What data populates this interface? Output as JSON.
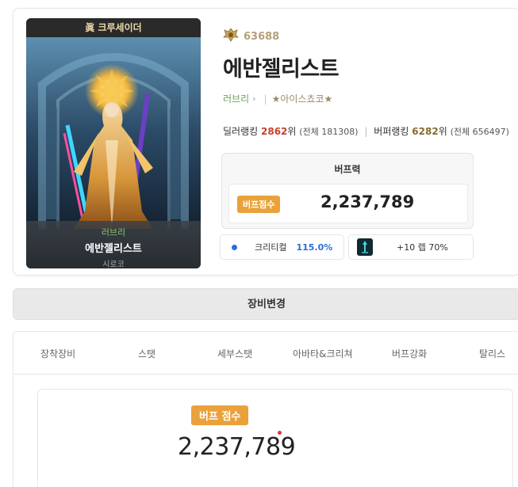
{
  "character": {
    "banner": "眞 크루세이더",
    "guild": "러브리",
    "name": "에반젤리스트",
    "server": "시로코",
    "fame": "63688",
    "adventure": "러브리",
    "title_tag": "★아이스쵸코★"
  },
  "ranking": {
    "dealer_label": "딜러랭킹",
    "dealer_rank": "2862",
    "dealer_suffix": "위",
    "dealer_total": "(전체 181308)",
    "buffer_label": "버퍼랭킹",
    "buffer_rank": "6282",
    "buffer_suffix": "위",
    "buffer_total": "(전체 656497)"
  },
  "buff": {
    "heading": "버프력",
    "badge": "버프점수",
    "score": "2,237,789"
  },
  "stats": {
    "crit_label": "크리티컬",
    "crit_value": "115.0%",
    "item_text": "+10 렙 70%"
  },
  "equip_change_label": "장비변경",
  "tabs": [
    "장착장비",
    "스탯",
    "세부스탯",
    "아바타&크리쳐",
    "버프강화",
    "탈리스"
  ],
  "score_card": {
    "badge": "버프 점수",
    "value": "2,237,789"
  },
  "colors": {
    "accent_orange": "#e9a23b",
    "rank_red": "#c8412c",
    "crit_blue": "#2a6fd8",
    "guild_green": "#6aa35a"
  },
  "icons": {
    "fame": "fame-crest-icon",
    "chevron": "chevron-right-icon",
    "crit_dot": "crit-dot-icon",
    "item": "weapon-item-icon"
  }
}
